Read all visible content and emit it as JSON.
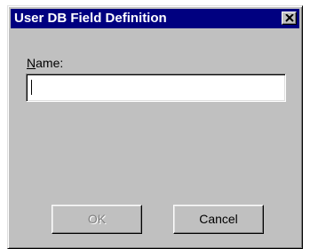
{
  "dialog": {
    "title": "User DB Field Definition",
    "close_icon": "close-x-icon"
  },
  "form": {
    "name_label": "Name:",
    "name_value": ""
  },
  "buttons": {
    "ok_label": "OK",
    "ok_enabled": false,
    "cancel_label": "Cancel"
  },
  "colors": {
    "title_bar": "#000080",
    "face": "#c0c0c0",
    "disabled_text": "#808080"
  }
}
